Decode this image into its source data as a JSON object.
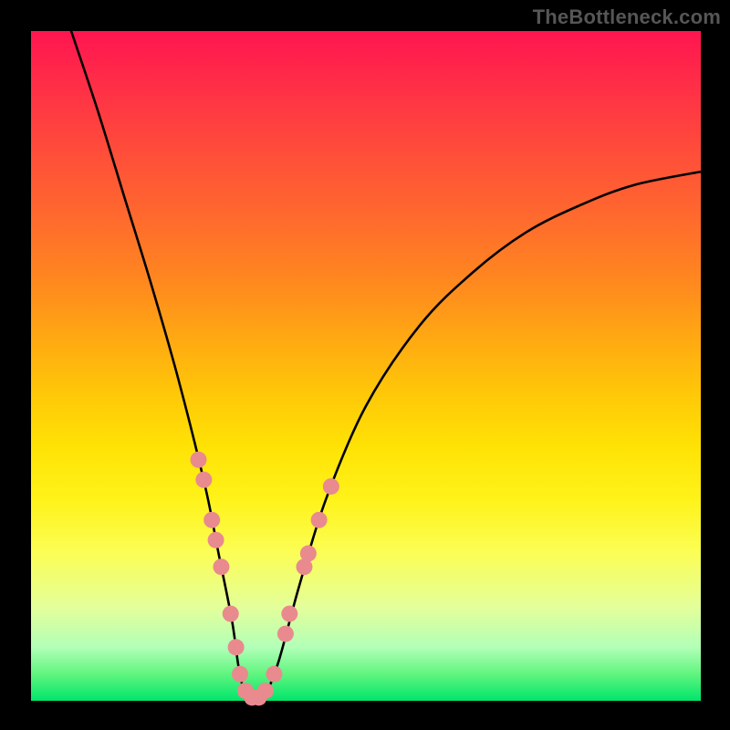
{
  "watermark": "TheBottleneck.com",
  "chart_data": {
    "type": "line",
    "title": "",
    "xlabel": "",
    "ylabel": "",
    "xlim": [
      0,
      100
    ],
    "ylim": [
      0,
      100
    ],
    "background_gradient": {
      "top": "#ff1550",
      "middle": "#ffe000",
      "bottom": "#00e56b"
    },
    "series": [
      {
        "name": "bottleneck-curve",
        "color": "#000000",
        "x": [
          6,
          10,
          14,
          18,
          22,
          26,
          28,
          30,
          31,
          32,
          33.5,
          35,
          37,
          40,
          44,
          50,
          58,
          66,
          74,
          82,
          90,
          100
        ],
        "values": [
          100,
          88,
          75,
          62,
          48,
          32,
          22,
          12,
          5,
          1,
          0,
          1,
          6,
          17,
          30,
          44,
          56,
          64,
          70,
          74,
          77,
          79
        ]
      }
    ],
    "markers": {
      "name": "highlighted-points",
      "color": "#e98a8f",
      "radius_px": 9,
      "points": [
        {
          "x": 25.0,
          "y": 36
        },
        {
          "x": 25.8,
          "y": 33
        },
        {
          "x": 27.0,
          "y": 27
        },
        {
          "x": 27.6,
          "y": 24
        },
        {
          "x": 28.4,
          "y": 20
        },
        {
          "x": 29.8,
          "y": 13
        },
        {
          "x": 30.6,
          "y": 8
        },
        {
          "x": 31.2,
          "y": 4
        },
        {
          "x": 32.0,
          "y": 1.5
        },
        {
          "x": 33.0,
          "y": 0.5
        },
        {
          "x": 34.0,
          "y": 0.5
        },
        {
          "x": 35.0,
          "y": 1.5
        },
        {
          "x": 36.3,
          "y": 4
        },
        {
          "x": 38.0,
          "y": 10
        },
        {
          "x": 38.6,
          "y": 13
        },
        {
          "x": 40.8,
          "y": 20
        },
        {
          "x": 41.4,
          "y": 22
        },
        {
          "x": 43.0,
          "y": 27
        },
        {
          "x": 44.8,
          "y": 32
        }
      ]
    }
  }
}
